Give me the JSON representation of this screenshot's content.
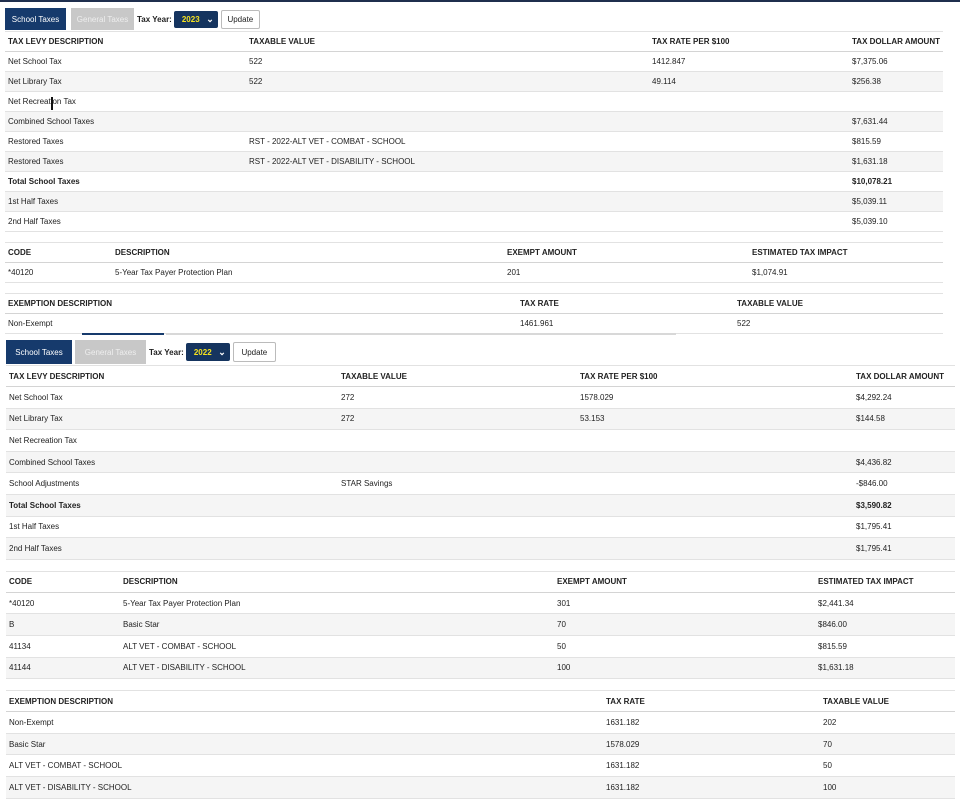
{
  "p2023": {
    "tabs": {
      "school": "School Taxes",
      "general": "General Taxes"
    },
    "tax_year_label": "Tax Year:",
    "tax_year": "2023",
    "update": "Update",
    "levy": {
      "headers": [
        "TAX LEVY DESCRIPTION",
        "TAXABLE VALUE",
        "TAX RATE PER $100",
        "TAX DOLLAR AMOUNT"
      ],
      "rows": [
        [
          "Net School Tax",
          "522",
          "1412.847",
          "$7,375.06"
        ],
        [
          "Net Library Tax",
          "522",
          "49.114",
          "$256.38"
        ],
        [
          "Net Recreation Tax",
          "",
          "",
          ""
        ],
        [
          "Combined School Taxes",
          "",
          "",
          "$7,631.44"
        ],
        [
          "Restored Taxes",
          "RST - 2022-ALT VET - COMBAT - SCHOOL",
          "",
          "$815.59"
        ],
        [
          "Restored Taxes",
          "RST - 2022-ALT VET - DISABILITY - SCHOOL",
          "",
          "$1,631.18"
        ],
        [
          "Total School Taxes",
          "",
          "",
          "$10,078.21"
        ],
        [
          "1st Half Taxes",
          "",
          "",
          "$5,039.11"
        ],
        [
          "2nd Half Taxes",
          "",
          "",
          "$5,039.10"
        ]
      ]
    },
    "codes": {
      "headers": [
        "CODE",
        "DESCRIPTION",
        "EXEMPT AMOUNT",
        "ESTIMATED TAX IMPACT"
      ],
      "rows": [
        [
          "*40120",
          "5-Year Tax Payer Protection Plan",
          "201",
          "$1,074.91"
        ]
      ]
    },
    "exemptions": {
      "headers": [
        "EXEMPTION DESCRIPTION",
        "TAX RATE",
        "TAXABLE VALUE"
      ],
      "rows": [
        [
          "Non-Exempt",
          "1461.961",
          "522"
        ]
      ]
    }
  },
  "p2022": {
    "tabs": {
      "school": "School Taxes",
      "general": "General Taxes"
    },
    "tax_year_label": "Tax Year:",
    "tax_year": "2022",
    "update": "Update",
    "levy": {
      "headers": [
        "TAX LEVY DESCRIPTION",
        "TAXABLE VALUE",
        "TAX RATE PER $100",
        "TAX DOLLAR AMOUNT"
      ],
      "rows": [
        [
          "Net School Tax",
          "272",
          "1578.029",
          "$4,292.24"
        ],
        [
          "Net Library Tax",
          "272",
          "53.153",
          "$144.58"
        ],
        [
          "Net Recreation Tax",
          "",
          "",
          ""
        ],
        [
          "Combined School Taxes",
          "",
          "",
          "$4,436.82"
        ],
        [
          "School Adjustments",
          "STAR Savings",
          "",
          "-$846.00"
        ],
        [
          "Total School Taxes",
          "",
          "",
          "$3,590.82"
        ],
        [
          "1st Half Taxes",
          "",
          "",
          "$1,795.41"
        ],
        [
          "2nd Half Taxes",
          "",
          "",
          "$1,795.41"
        ]
      ]
    },
    "codes": {
      "headers": [
        "CODE",
        "DESCRIPTION",
        "EXEMPT AMOUNT",
        "ESTIMATED TAX IMPACT"
      ],
      "rows": [
        [
          "*40120",
          "5-Year Tax Payer Protection Plan",
          "301",
          "$2,441.34"
        ],
        [
          "B",
          "Basic Star",
          "70",
          "$846.00"
        ],
        [
          "41134",
          "ALT VET - COMBAT - SCHOOL",
          "50",
          "$815.59"
        ],
        [
          "41144",
          "ALT VET - DISABILITY - SCHOOL",
          "100",
          "$1,631.18"
        ]
      ]
    },
    "exemptions": {
      "headers": [
        "EXEMPTION DESCRIPTION",
        "TAX RATE",
        "TAXABLE VALUE"
      ],
      "rows": [
        [
          "Non-Exempt",
          "1631.182",
          "202"
        ],
        [
          "Basic Star",
          "1578.029",
          "70"
        ],
        [
          "ALT VET - COMBAT - SCHOOL",
          "1631.182",
          "50"
        ],
        [
          "ALT VET - DISABILITY - SCHOOL",
          "1631.182",
          "100"
        ]
      ]
    }
  },
  "colors": {
    "tab_active": "#163a6c",
    "tab_inactive": "#c8c8c8",
    "year_text": "#f5e21f"
  }
}
